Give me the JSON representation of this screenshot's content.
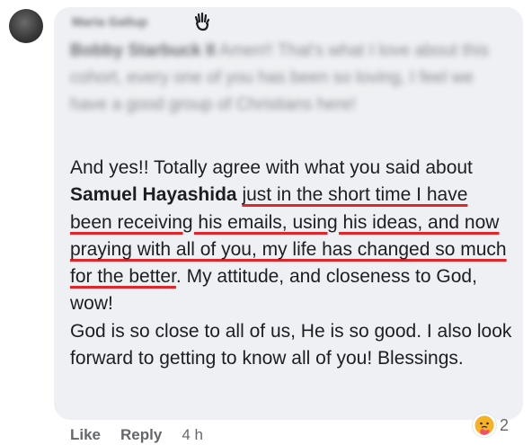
{
  "comment": {
    "author_name": "Maria Gallup",
    "quoted_author": "Bobby Starbuck II",
    "quoted_text": "Amen!! That's what I love about this cohort, every one of you has been so loving, I feel we have a good group of Christians here!",
    "body": {
      "p1": "And yes!! Totally agree with what you said about ",
      "mention": "Samuel Hayashida",
      "space": " ",
      "underlined": "just in the short time I have been receiving his emails, using his ideas, and now praying with all of you, my life has changed so much for the better",
      "p2": ". My attitude, and closeness to God, wow!",
      "p3": "God is so close to all of us, He is so good. I also look forward to getting to know all of you! Blessings."
    },
    "reaction_count": "2",
    "actions": {
      "like": "Like",
      "reply": "Reply",
      "time": "4 h"
    }
  },
  "icons": {
    "avatar": "profile-photo",
    "quote": "raised-hand-icon",
    "reaction": "care-emoji-icon"
  },
  "colors": {
    "bubble": "#eef0f3",
    "underline": "#e3242b",
    "text": "#1c1e21",
    "meta": "#65676b"
  }
}
